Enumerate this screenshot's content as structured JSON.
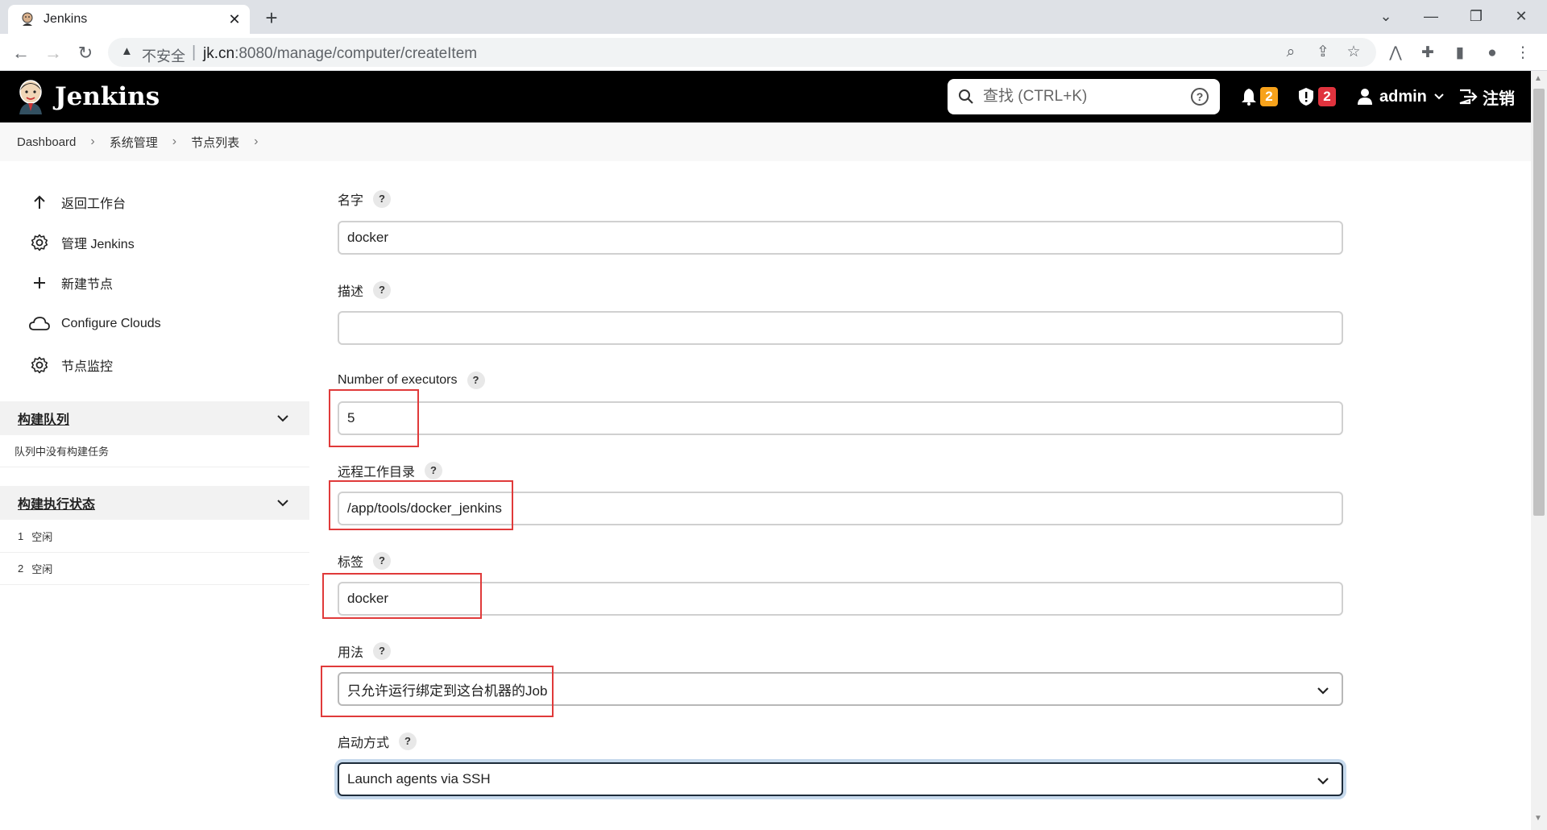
{
  "browser": {
    "tab_title": "Jenkins",
    "tab_close_icon": "close-icon",
    "new_tab_icon": "plus-icon",
    "window_controls": [
      "chevron-down-icon",
      "minimize-icon",
      "restore-icon",
      "close-icon"
    ],
    "nav": {
      "back": "back-icon",
      "forward": "forward-icon",
      "reload": "reload-icon"
    },
    "security_label": "不安全",
    "url_host": "jk.cn",
    "url_path": ":8080/manage/computer/createItem",
    "omnibox_icons": [
      "zoom-icon",
      "share-icon",
      "star-icon"
    ],
    "extension_icons": [
      "extension-app-icon",
      "puzzle-icon",
      "sidebar-icon",
      "profile-icon",
      "kebab-menu-icon"
    ]
  },
  "header": {
    "brand": "Jenkins",
    "search_placeholder": "查找 (CTRL+K)",
    "notifications_count": "2",
    "security_count": "2",
    "user": "admin",
    "logout": "注销",
    "colors": {
      "background": "#000000",
      "warning_badge": "#f7a21b",
      "security_badge": "#e0333e"
    }
  },
  "breadcrumb": [
    "Dashboard",
    "系统管理",
    "节点列表"
  ],
  "sidebar": {
    "tasks": [
      {
        "label": "返回工作台",
        "icon": "arrow-up-icon"
      },
      {
        "label": "管理 Jenkins",
        "icon": "gear-icon"
      },
      {
        "label": "新建节点",
        "icon": "plus-icon"
      },
      {
        "label": "Configure Clouds",
        "icon": "cloud-icon"
      },
      {
        "label": "节点监控",
        "icon": "gear-icon"
      }
    ],
    "build_queue": {
      "title": "构建队列",
      "empty_text": "队列中没有构建任务"
    },
    "executors": {
      "title": "构建执行状态",
      "rows": [
        {
          "num": "1",
          "status": "空闲"
        },
        {
          "num": "2",
          "status": "空闲"
        }
      ]
    }
  },
  "form": {
    "name": {
      "label": "名字",
      "value": "docker"
    },
    "description": {
      "label": "描述",
      "value": ""
    },
    "executors": {
      "label": "Number of executors",
      "value": "5"
    },
    "remote_dir": {
      "label": "远程工作目录",
      "value": "/app/tools/docker_jenkins"
    },
    "labels": {
      "label": "标签",
      "value": "docker"
    },
    "usage": {
      "label": "用法",
      "value": "只允许运行绑定到这台机器的Job"
    },
    "launch": {
      "label": "启动方式",
      "value": "Launch agents via SSH"
    },
    "help_text": "?"
  },
  "annotation_color": "#e03a3a"
}
